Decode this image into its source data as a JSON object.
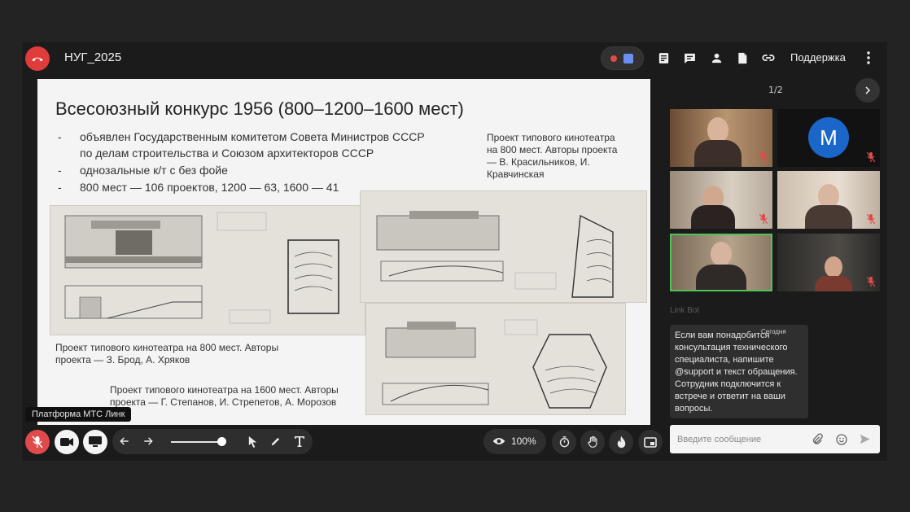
{
  "meeting": {
    "title": "НУГ_2025",
    "support_label": "Поддержка",
    "pager": "1/2"
  },
  "slide": {
    "title": "Всесоюзный конкурс 1956 (800–1200–1600 мест)",
    "bullets": [
      {
        "dash": "-",
        "text": "объявлен Государственным комитетом Совета Министров СССР"
      },
      {
        "dash": "",
        "text": "по делам строительства и Союзом архитекторов СССР"
      },
      {
        "dash": "-",
        "text": "однозальные к/т с без фойе"
      },
      {
        "dash": "-",
        "text": "800 мест — 106 проектов, 1200 — 63, 1600 — 41"
      }
    ],
    "captions": {
      "right_top": [
        "Проект типового кинотеатра",
        "на 800 мест. Авторы проекта",
        "— В. Красильников, И.",
        "Кравчинская"
      ],
      "left": [
        "Проект типового кинотеатра на 800 мест. Авторы",
        "проекта — З. Брод, А. Хряков"
      ],
      "bottom": [
        "Проект типового кинотеатра на 1600 мест. Авторы",
        "проекта — Г. Степанов, И. Стрепетов, А. Морозов"
      ]
    }
  },
  "participants": [
    {
      "name": "participant-1",
      "muted": true
    },
    {
      "name": "participant-m",
      "initial": "M",
      "muted": true
    },
    {
      "name": "participant-3",
      "muted": true
    },
    {
      "name": "participant-4",
      "muted": true
    },
    {
      "name": "participant-5-speaking",
      "muted": false
    },
    {
      "name": "participant-6",
      "muted": true
    }
  ],
  "chat": {
    "bot_name": "Link Bot",
    "today_label": "Сегодня",
    "message_lines": [
      "Если вам понадобится",
      "консультация технического",
      "специалиста, напишите",
      "@support и текст обращения.",
      "Сотрудник подключится к",
      "встрече и ответит на ваши",
      "вопросы."
    ],
    "input_placeholder": "Введите сообщение"
  },
  "toolbar": {
    "tooltip": "Платформа МТС Линк",
    "zoom_label": "100%",
    "slider_level": 0.95
  },
  "colors": {
    "hangup": "#e03c3c",
    "record_dot": "#e34a4a",
    "active_speaker": "#4fc35a",
    "avatar_m": "#1b66c9",
    "mic_off_red": "#e14b4b"
  }
}
